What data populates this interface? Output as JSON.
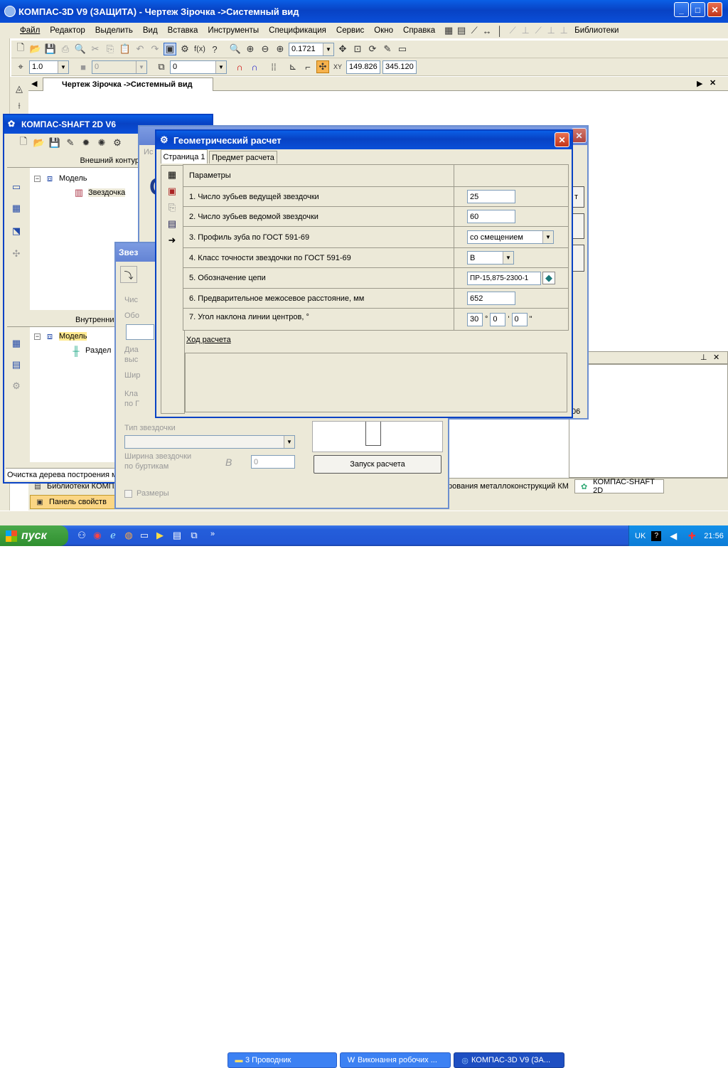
{
  "main_window": {
    "title": "КОМПАС-3D V9 (ЗАЩИТА) - Чертеж Зірочка ->Системный вид",
    "menu": [
      "Файл",
      "Редактор",
      "Выделить",
      "Вид",
      "Вставка",
      "Инструменты",
      "Спецификация",
      "Сервис",
      "Окно",
      "Справка"
    ],
    "menu_libraries": "Библиотеки",
    "zoom_value": "0.1721",
    "line_scale_value": "1.0",
    "layer_combo_value": "0",
    "style_combo_value": "0",
    "coord_x": "149.826",
    "coord_y": "345.120",
    "doc_tab": "Чертеж Зірочка ->Системный вид"
  },
  "shaft_window": {
    "title": "КОМПАС-SHAFT 2D V6",
    "outer_contour": "Внешний контур",
    "tree1": {
      "root": "Модель",
      "child": "Звездочка"
    },
    "inner_contour": "Внутренний",
    "tree2": {
      "root": "Модель",
      "child": "Раздел"
    },
    "status": "Очистка дерева построения м"
  },
  "sprocket_panel": {
    "title": "Звез",
    "fields_faint": [
      "Чис",
      "Обо",
      "Диа",
      "выс",
      "Шир",
      "Кла",
      "по Г"
    ],
    "type_label": "Тип звездочки",
    "width_label_1": "Ширина звездочки",
    "width_label_2": "по буртикам",
    "width_symbol": "B",
    "width_value": "0",
    "sizes_checkbox": "Размеры",
    "start_button": "Запуск расчета"
  },
  "bg_dialog": {
    "tab_faint": "Ис",
    "right_btn_text": "т",
    "number_tail": "06"
  },
  "geom_dialog": {
    "title": "Геометрический расчет",
    "tabs": [
      "Страница 1",
      "Предмет расчета"
    ],
    "header": "Параметры",
    "rows": [
      {
        "label": "1. Число зубьев ведущей звездочки",
        "value": "25"
      },
      {
        "label": "2. Число зубьев ведомой звездочки",
        "value": "60"
      },
      {
        "label": "3. Профиль зуба по ГОСТ 591-69",
        "value": "со смещением"
      },
      {
        "label": "4. Класс точности звездочки по ГОСТ 591-69",
        "value": "В"
      },
      {
        "label": "5. Обозначение цепи",
        "value": "ПР-15,875-2300-1"
      },
      {
        "label": "6. Предварительное межосевое расстояние, мм",
        "value": "652"
      },
      {
        "label": "7. Угол наклона линии центров, °",
        "deg": "30",
        "min": "0",
        "sec": "0"
      }
    ],
    "progress_link": "Ход расчета"
  },
  "bottom_tabs": {
    "libraries": "Библиотеки КОМПАС",
    "properties": "Панель свойств",
    "metal": "рования металлоконструкций КМ",
    "shaft": "КОМПАС-SHAFT 2D"
  },
  "taskbar": {
    "start": "пуск",
    "items": [
      "3 Проводник",
      "Виконання робочих ...",
      "КОМПАС-3D V9 (ЗА..."
    ],
    "lang": "UK",
    "clock": "21:56"
  }
}
